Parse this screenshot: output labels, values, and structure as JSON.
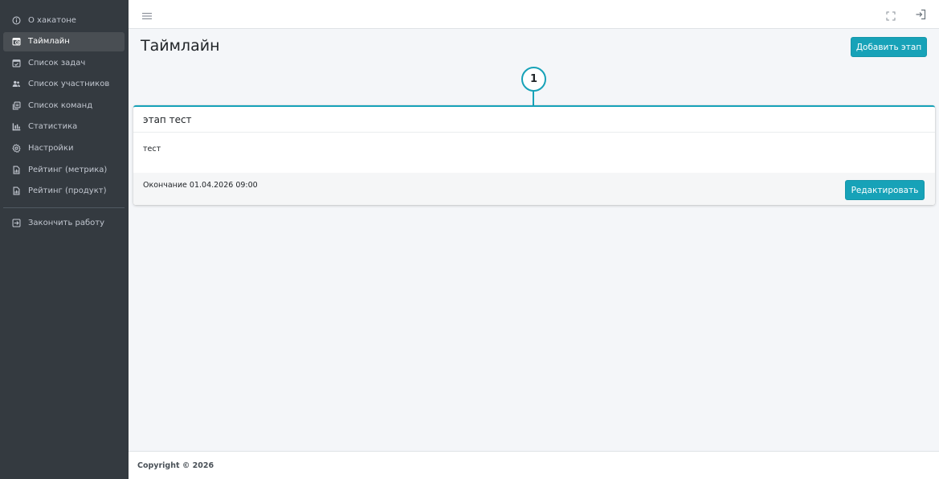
{
  "sidebar": {
    "items": [
      {
        "label": "О хакатоне",
        "icon": "info-circle-icon",
        "active": false
      },
      {
        "label": "Таймлайн",
        "icon": "calendar-clock-icon",
        "active": true
      },
      {
        "label": "Список задач",
        "icon": "calendar-check-icon",
        "active": false
      },
      {
        "label": "Список участников",
        "icon": "users-icon",
        "active": false
      },
      {
        "label": "Список команд",
        "icon": "copy-icon",
        "active": false
      },
      {
        "label": "Статистика",
        "icon": "bar-chart-icon",
        "active": false
      },
      {
        "label": "Настройки",
        "icon": "gear-icon",
        "active": false
      },
      {
        "label": "Рейтинг (метрика)",
        "icon": "document-icon",
        "active": false
      },
      {
        "label": "Рейтинг (продукт)",
        "icon": "document-icon",
        "active": false
      }
    ],
    "logout_label": "Закончить работу"
  },
  "topbar": {
    "menu_icon": "hamburger-icon",
    "fullscreen_icon": "fullscreen-icon",
    "logout_icon": "logout-icon"
  },
  "page": {
    "title": "Таймлайн",
    "add_button": "Добавить этап"
  },
  "timeline": {
    "marker": "1",
    "stage": {
      "title": "этап тест",
      "description": "тест",
      "end_text": "Окончание 01.04.2026 09:00",
      "edit_button": "Редактировать"
    }
  },
  "footer": {
    "copyright": "Copyright © 2026"
  },
  "colors": {
    "sidebar_bg": "#343a40",
    "accent": "#17a2b8",
    "content_bg": "#f4f6f9"
  }
}
